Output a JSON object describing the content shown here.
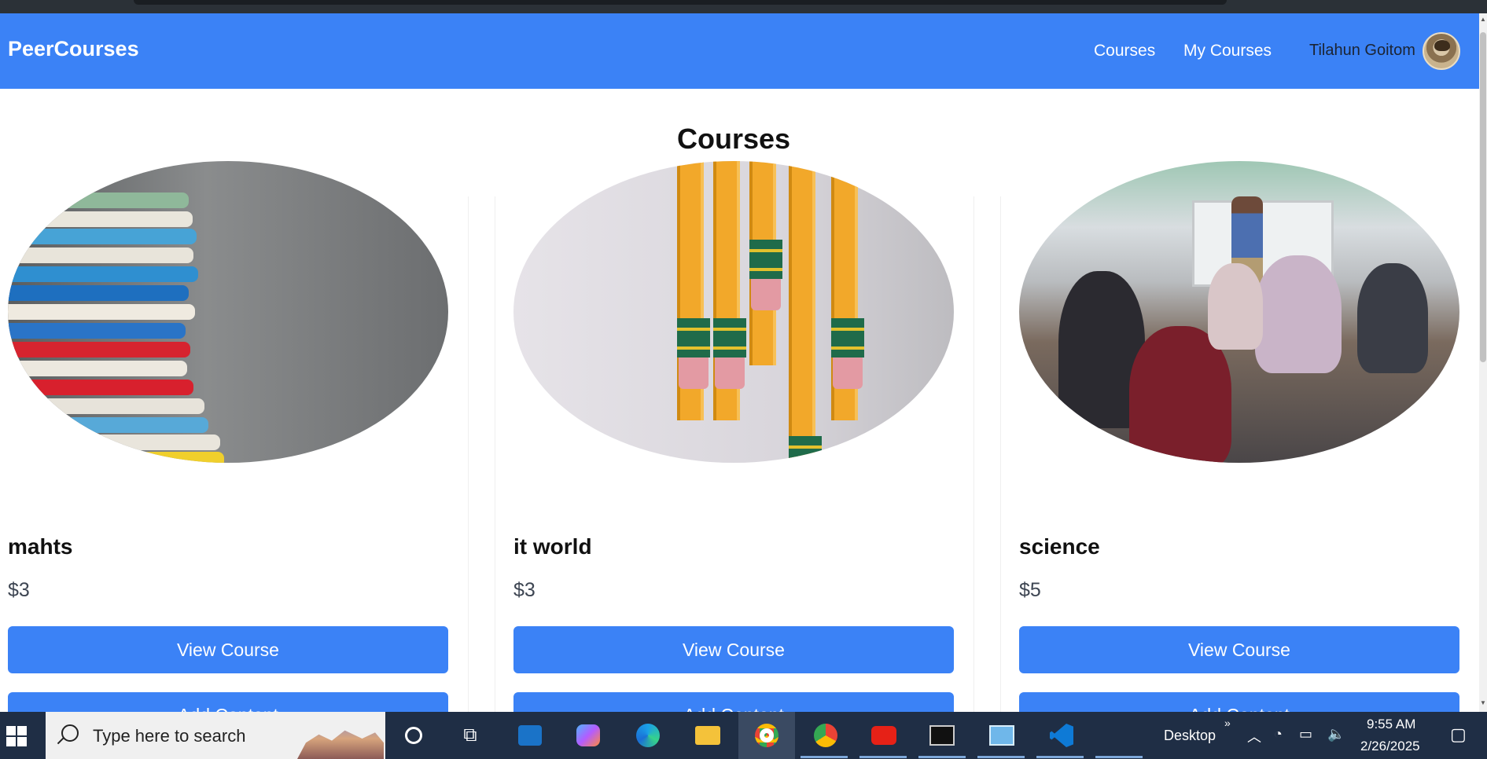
{
  "header": {
    "brand": "PeerCourses",
    "nav": [
      "Courses",
      "My Courses"
    ],
    "user_name": "Tilahun Goitom"
  },
  "main": {
    "title": "Courses",
    "courses": [
      {
        "title": "mahts",
        "price": "$3",
        "view_label": "View Course",
        "add_label": "Add Content"
      },
      {
        "title": "it world",
        "price": "$3",
        "view_label": "View Course",
        "add_label": "Add Content"
      },
      {
        "title": "science",
        "price": "$5",
        "view_label": "View Course",
        "add_label": "Add Content"
      }
    ]
  },
  "taskbar": {
    "search_placeholder": "Type here to search",
    "desktop_label": "Desktop",
    "time": "9:55 AM",
    "date": "2/26/2025"
  },
  "colors": {
    "accent": "#3b82f6",
    "taskbar": "#1f2e45"
  }
}
